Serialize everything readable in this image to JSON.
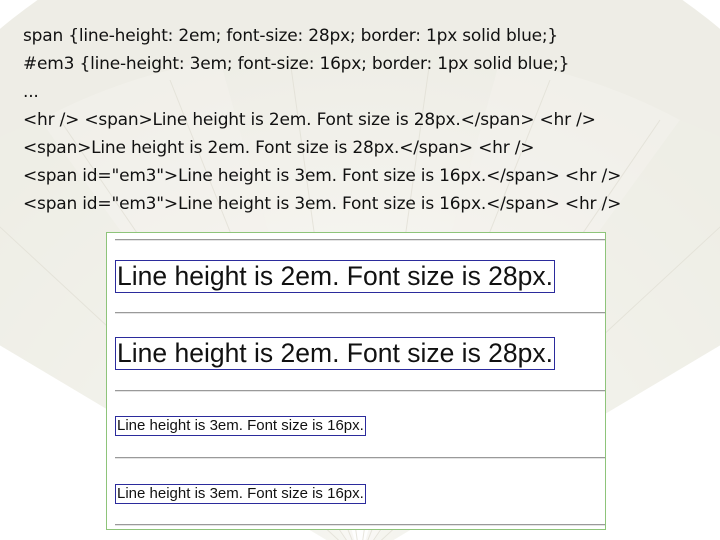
{
  "slide": {
    "code_lines": [
      "span {line-height: 2em; font-size: 28px; border: 1px solid blue;}",
      "#em3 {line-height: 3em; font-size: 16px; border: 1px solid blue;}",
      "...",
      "<hr /> <span>Line height is 2em. Font size is 28px.</span> <hr />",
      "<span>Line height is 2em. Font size is 28px.</span> <hr />",
      "<span id=\"em3\">Line height is 3em. Font size is 16px.</span> <hr />",
      "<span id=\"em3\">Line height is 3em. Font size is 16px.</span> <hr />"
    ]
  },
  "demo": {
    "spans": [
      "Line height is 2em. Font size is 28px.",
      "Line height is 2em. Font size is 28px.",
      "Line height is 3em. Font size is 16px.",
      "Line height is 3em. Font size is 16px."
    ]
  }
}
